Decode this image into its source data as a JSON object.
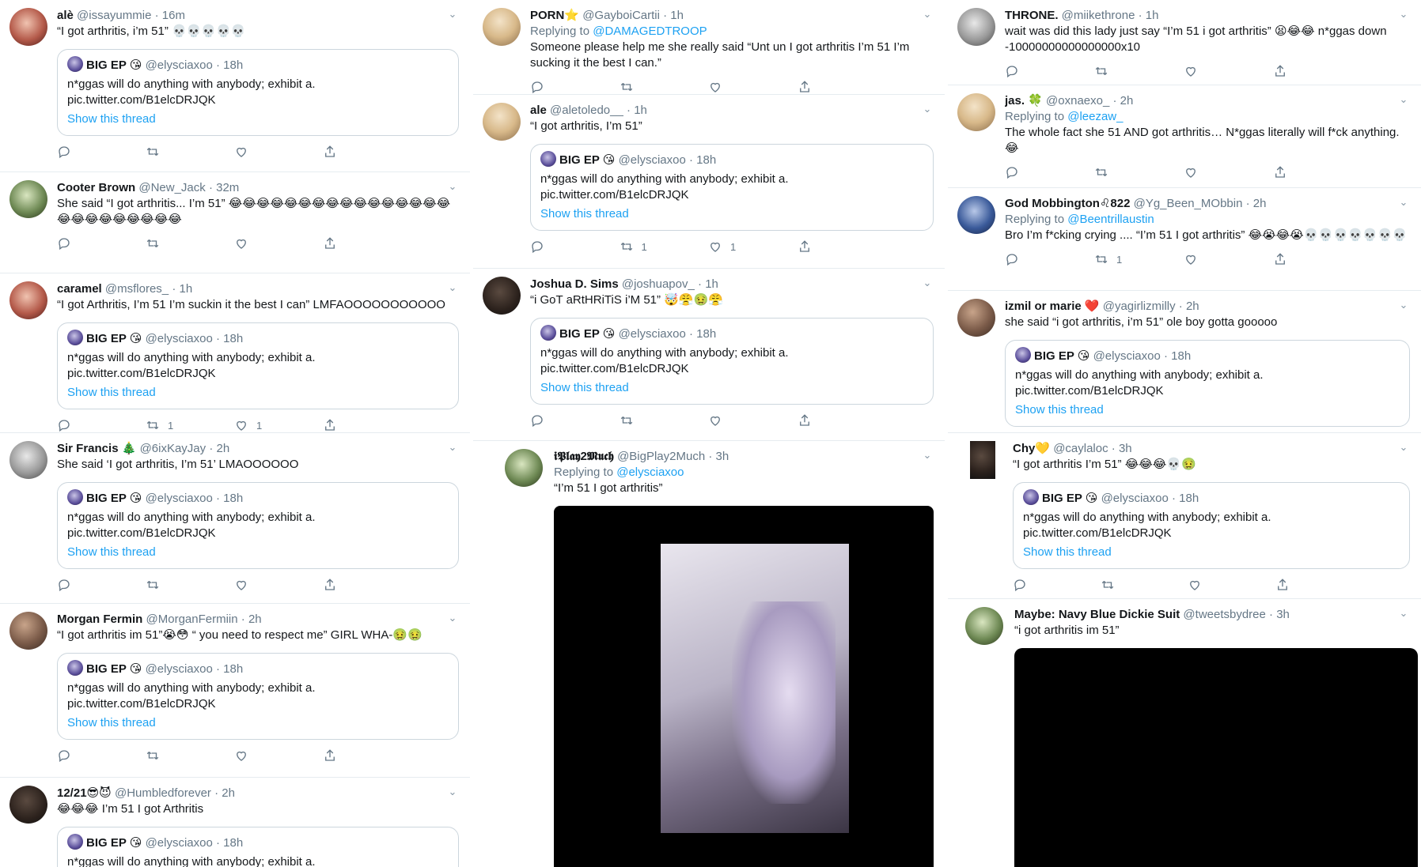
{
  "col1": [
    {
      "name": "alè",
      "handle": "@issayummie",
      "time": "16m",
      "text": "“I got arthritis, i’m 51” 💀💀💀💀💀",
      "replying_to": "",
      "quote": {
        "name": "BIG EP 😘",
        "handle": "@elysciaxoo",
        "time": "18h",
        "text": "n*ggas will do anything with anybody; exhibit a. pic.twitter.com/B1elcDRJQK",
        "show": "Show this thread"
      }
    },
    {
      "name": "Cooter Brown",
      "handle": "@New_Jack",
      "time": "32m",
      "text": "She said “I got arthritis... I’m 51” 😂😂😂😂😂😂😂😂😂😂😂😂😂😂😂😂😂😂😂😂😂😂😂😂😂",
      "replying_to": "",
      "quote": null
    },
    {
      "name": "caramel",
      "handle": "@msflores_",
      "time": "1h",
      "text": "“I got Arthritis, I’m 51 I’m suckin it the best I can” LMFAOOOOOOOOOOO",
      "replying_to": "",
      "quote": {
        "name": "BIG EP 😘",
        "handle": "@elysciaxoo",
        "time": "18h",
        "text": "n*ggas will do anything with anybody; exhibit a. pic.twitter.com/B1elcDRJQK",
        "show": "Show this thread"
      },
      "reply_count": "",
      "rt_count": "1",
      "like_count": "1"
    },
    {
      "name": "Sir Francis 🎄",
      "handle": "@6ixKayJay",
      "time": "2h",
      "text": "She said ‘I got arthritis, I’m 51’ LMAOOOOOO",
      "replying_to": "",
      "quote": {
        "name": "BIG EP 😘",
        "handle": "@elysciaxoo",
        "time": "18h",
        "text": "n*ggas will do anything with anybody; exhibit a. pic.twitter.com/B1elcDRJQK",
        "show": "Show this thread"
      }
    },
    {
      "name": "Morgan Fermin",
      "handle": "@MorganFermiin",
      "time": "2h",
      "text": "“I got arthritis im 51”😭😳 “ you need to respect me” GIRL WHA-🤢🤢",
      "replying_to": "",
      "quote": {
        "name": "BIG EP 😘",
        "handle": "@elysciaxoo",
        "time": "18h",
        "text": "n*ggas will do anything with anybody; exhibit a. pic.twitter.com/B1elcDRJQK",
        "show": "Show this thread"
      }
    },
    {
      "name": "12/21😎😈",
      "handle": "@Humbledforever",
      "time": "2h",
      "text": "😂😂😂 I’m 51 I got Arthritis",
      "replying_to": "",
      "quote": {
        "name": "BIG EP 😘",
        "handle": "@elysciaxoo",
        "time": "18h",
        "text": "n*ggas will do anything with anybody; exhibit a.",
        "show": ""
      }
    }
  ],
  "col2": [
    {
      "name": "PORN⭐",
      "handle": "@GayboiCartii",
      "time": "1h",
      "replying_to": "@DAMAGEDTROOP",
      "text": "Someone please help me she really said “Unt un I got arthritis I’m 51 I’m sucking it the best I can.”",
      "quote": null
    },
    {
      "name": "ale",
      "handle": "@aletoledo__",
      "time": "1h",
      "replying_to": "",
      "text": "“I got arthritis, I’m 51”",
      "quote": {
        "name": "BIG EP 😘",
        "handle": "@elysciaxoo",
        "time": "18h",
        "text": "n*ggas will do anything with anybody; exhibit a. pic.twitter.com/B1elcDRJQK",
        "show": "Show this thread"
      },
      "rt_count": "1",
      "like_count": "1"
    },
    {
      "name": "Joshua D. Sims",
      "handle": "@joshuapov_",
      "time": "1h",
      "replying_to": "",
      "text": "“i GoT aRtHRiTiS i’M 51” 🤯😤🤢😤",
      "quote": {
        "name": "BIG EP 😘",
        "handle": "@elysciaxoo",
        "time": "18h",
        "text": "n*ggas will do anything with anybody; exhibit a. pic.twitter.com/B1elcDRJQK",
        "show": "Show this thread"
      }
    },
    {
      "name": "𝖎𝕻𝖑𝖆𝖞2𝕸𝖚𝖈𝖍",
      "handle": "@BigPlay2Much",
      "time": "3h",
      "replying_to": "@elysciaxoo",
      "text": "“I’m 51 I got arthritis”",
      "quote": null,
      "media": true
    }
  ],
  "col3": [
    {
      "name": "THRONE.",
      "handle": "@miikethrone",
      "time": "1h",
      "replying_to": "",
      "text": "wait was did this lady just say “I’m 51 i got arthritis” 😫😂😂 n*ggas down -10000000000000000x10",
      "quote": null
    },
    {
      "name": "jas. 🍀",
      "handle": "@oxnaexo_",
      "time": "2h",
      "replying_to": "@leezaw_",
      "text": "The whole fact she 51 AND got arthritis… N*ggas literally will f*ck anything. 😂",
      "quote": null
    },
    {
      "name": "God Mobbington♌822",
      "handle": "@Yg_Been_MObbin",
      "time": "2h",
      "replying_to": "@Beentrillaustin",
      "text": "Bro I’m f*cking crying .... “I’m 51 I got arthritis” 😂😭😂😭💀💀💀💀💀💀💀",
      "quote": null,
      "rt_count": "1"
    },
    {
      "name": "izmil or marie ❤️",
      "handle": "@yagirlizmilly",
      "time": "2h",
      "replying_to": "",
      "text": "she said “i got arthritis, i’m 51” ole boy gotta gooooo",
      "quote": {
        "name": "BIG EP 😘",
        "handle": "@elysciaxoo",
        "time": "18h",
        "text": "n*ggas will do anything with anybody; exhibit a. pic.twitter.com/B1elcDRJQK",
        "show": "Show this thread"
      }
    },
    {
      "name": "Chy💛",
      "handle": "@caylaloc",
      "time": "3h",
      "replying_to": "",
      "text": "“I got arthritis I’m 51” 😂😂😂💀🤢",
      "quote": {
        "name": "BIG EP 😘",
        "handle": "@elysciaxoo",
        "time": "18h",
        "text": "n*ggas will do anything with anybody; exhibit a. pic.twitter.com/B1elcDRJQK",
        "show": "Show this thread"
      }
    },
    {
      "name": "Maybe: Navy Blue Dickie Suit",
      "handle": "@tweetsbydree",
      "time": "3h",
      "replying_to": "",
      "text": "“i got arthritis im 51”",
      "quote": null,
      "media": true
    }
  ],
  "colors": {
    "link": "#1da1f2",
    "muted": "#657786",
    "border": "#e6ecf0",
    "quote_border": "#ccd6dd"
  },
  "icons": [
    "reply-icon",
    "retweet-icon",
    "like-icon",
    "share-icon",
    "caret-down-icon"
  ]
}
